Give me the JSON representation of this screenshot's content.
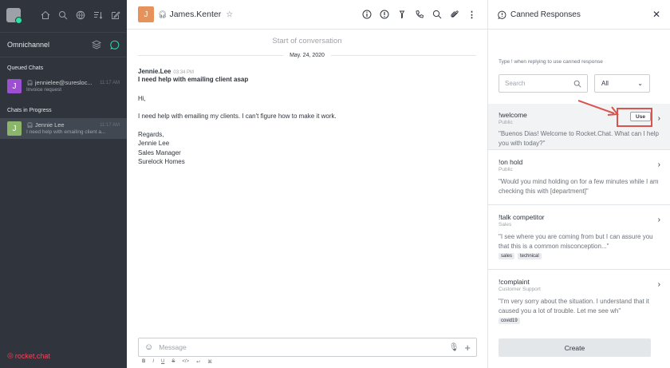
{
  "sidebar": {
    "section_title": "Omnichannel",
    "queued_title": "Queued Chats",
    "queued": [
      {
        "initial": "J",
        "name": "jennielee@suresloc...",
        "time": "11:17 AM",
        "preview": "Invoice request",
        "color": "#9d4fd1"
      }
    ],
    "in_progress_title": "Chats in Progress",
    "in_progress": [
      {
        "initial": "J",
        "name": "Jennie Lee",
        "time": "11:17 AM",
        "preview": "I need help with emailing client a...",
        "color": "#8ab56b"
      }
    ],
    "brand": "rocket.chat"
  },
  "header": {
    "avatar_initial": "J",
    "room_name": "James.Kenter"
  },
  "conversation": {
    "start_label": "Start of conversation",
    "date": "May. 24, 2020",
    "message": {
      "author": "Jennie.Lee",
      "time": "03:34 PM",
      "subject": "I need help with emailing client asap",
      "greeting": "Hi,",
      "body": "I need help with emailing my clients. I can't figure how to make it work.",
      "closing": [
        "Regards,",
        "Jennie Lee",
        "Sales Manager",
        "Surelock Homes"
      ]
    }
  },
  "composer": {
    "placeholder": "Message"
  },
  "formatting": [
    "B",
    "I",
    "U",
    "S",
    "</>",
    "↩",
    "⌘"
  ],
  "panel": {
    "title": "Canned Responses",
    "hint": "Type ! when replying to use canned response",
    "search_placeholder": "Search",
    "filter_value": "All",
    "use_label": "Use",
    "create_label": "Create",
    "items": [
      {
        "name": "!welcome",
        "scope": "Public",
        "text": "\"Buenos Dias! Welcome to Rocket.Chat. What can I help you with today?\"",
        "tags": []
      },
      {
        "name": "!on hold",
        "scope": "Public",
        "text": "\"Would you mind holding on for a few minutes while I am checking this with [department]\"",
        "tags": []
      },
      {
        "name": "!talk competitor",
        "scope": "Sales",
        "text": "\"I see where you are coming from but I can assure you that this is a common misconception...\"",
        "tags": [
          "sales",
          "technical"
        ]
      },
      {
        "name": "!complaint",
        "scope": "Customer Support",
        "text": "\"I'm very sorry about the situation. I understand that it caused you a lot of trouble. Let me see wh\"",
        "tags": [
          "covid19"
        ]
      }
    ]
  },
  "colors": {
    "sidebar_bg": "#2f343d",
    "brand": "#f5455c",
    "annotation": "#d9534f"
  }
}
